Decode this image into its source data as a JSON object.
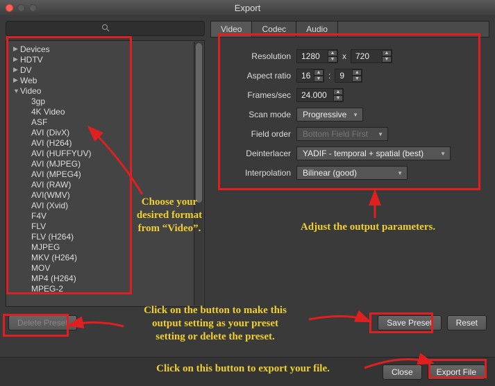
{
  "window": {
    "title": "Export"
  },
  "search": {
    "placeholder": ""
  },
  "tree": {
    "categories": [
      {
        "label": "Devices",
        "expanded": false
      },
      {
        "label": "HDTV",
        "expanded": false
      },
      {
        "label": "DV",
        "expanded": false
      },
      {
        "label": "Web",
        "expanded": false
      },
      {
        "label": "Video",
        "expanded": true
      }
    ],
    "video_items": [
      "3gp",
      "4K Video",
      "ASF",
      "AVI (DivX)",
      "AVI (H264)",
      "AVI (HUFFYUV)",
      "AVI (MJPEG)",
      "AVI (MPEG4)",
      "AVI (RAW)",
      "AVI(WMV)",
      "AVI (Xvid)",
      "F4V",
      "FLV",
      "FLV (H264)",
      "MJPEG",
      "MKV (H264)",
      "MOV",
      "MP4 (H264)",
      "MPEG-2"
    ]
  },
  "tabs": [
    {
      "label": "Video",
      "active": true
    },
    {
      "label": "Codec",
      "active": false
    },
    {
      "label": "Audio",
      "active": false
    }
  ],
  "form": {
    "resolution": {
      "label": "Resolution",
      "w": "1280",
      "sep": "x",
      "h": "720"
    },
    "aspect": {
      "label": "Aspect ratio",
      "a": "16",
      "sep": ":",
      "b": "9"
    },
    "fps": {
      "label": "Frames/sec",
      "value": "24.000"
    },
    "scan": {
      "label": "Scan mode",
      "value": "Progressive"
    },
    "field": {
      "label": "Field order",
      "value": "Bottom Field First"
    },
    "deint": {
      "label": "Deinterlacer",
      "value": "YADIF - temporal + spatial (best)"
    },
    "interp": {
      "label": "Interpolation",
      "value": "Bilinear (good)"
    }
  },
  "buttons": {
    "delete_preset": "Delete Preset",
    "save_preset": "Save Preset",
    "reset": "Reset",
    "close": "Close",
    "export_file": "Export File"
  },
  "annotations": {
    "choose_format": "Choose your\ndesired format\nfrom “Video”.",
    "adjust_params": "Adjust the output parameters.",
    "preset_hint": "Click on the button to make this\noutput setting as your preset\nsetting or delete the preset.",
    "export_hint": "Click on this button to export your file."
  }
}
